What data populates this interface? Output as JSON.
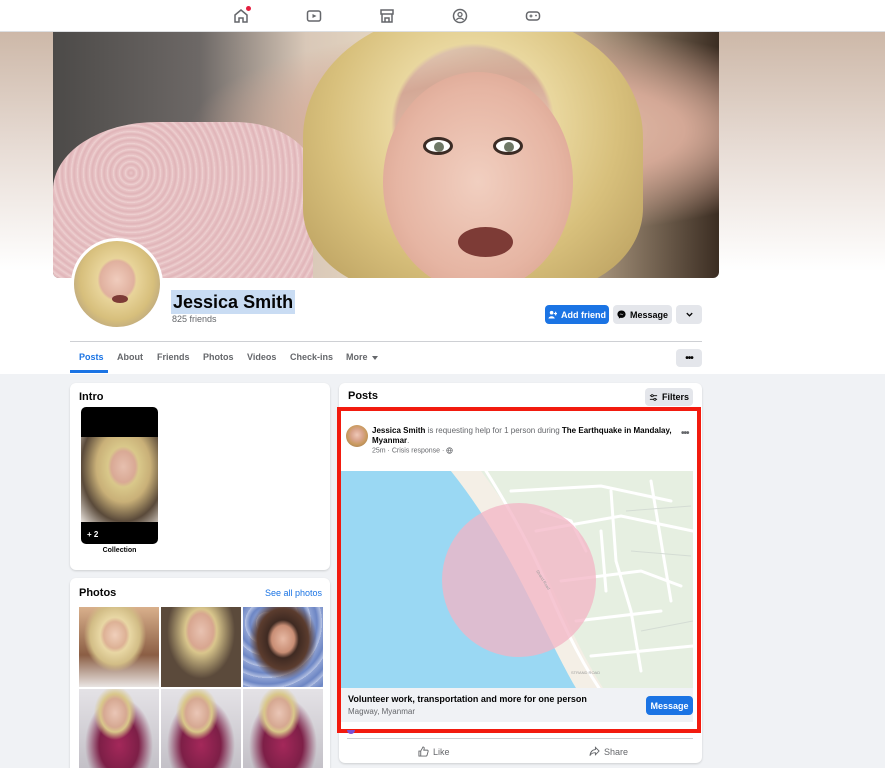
{
  "nav": {
    "icons": [
      "home-icon",
      "video-icon",
      "marketplace-icon",
      "groups-icon",
      "gaming-icon"
    ]
  },
  "profile": {
    "name": "Jessica Smith",
    "friends": "825 friends"
  },
  "actions": {
    "add_friend": "Add friend",
    "message": "Message"
  },
  "tabs": [
    {
      "label": "Posts"
    },
    {
      "label": "About"
    },
    {
      "label": "Friends"
    },
    {
      "label": "Photos"
    },
    {
      "label": "Videos"
    },
    {
      "label": "Check-ins"
    },
    {
      "label": "More"
    }
  ],
  "intro": {
    "title": "Intro",
    "collection_count": "+ 2",
    "collection_label": "Collection"
  },
  "photos": {
    "title": "Photos",
    "see_all": "See all photos"
  },
  "posts": {
    "title": "Posts",
    "filters": "Filters"
  },
  "post": {
    "author": "Jessica Smith",
    "text_middle": " is requesting help for 1 person during ",
    "event": "The Earthquake in Mandalay, Myanmar",
    "time": "25m · Crisis response ·",
    "map_label_street": "Strand Road",
    "map_label_road": "STRAND ROAD",
    "request_title": "Volunteer work, transportation and more for one person",
    "request_location": "Magway, Myanmar",
    "message_button": "Message",
    "like": "Like",
    "share": "Share"
  }
}
